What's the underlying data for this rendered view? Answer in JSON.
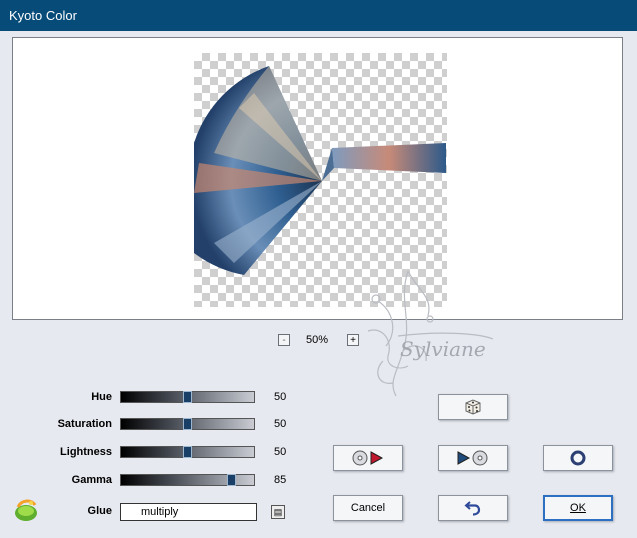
{
  "window": {
    "title": "Kyoto Color"
  },
  "zoom": {
    "minus_label": "-",
    "value": "50%",
    "plus_label": "+"
  },
  "controls": [
    {
      "label": "Hue",
      "value": "50"
    },
    {
      "label": "Saturation",
      "value": "50"
    },
    {
      "label": "Lightness",
      "value": "50"
    },
    {
      "label": "Gamma",
      "value": "85"
    }
  ],
  "glue": {
    "label": "Glue",
    "value": "multiply"
  },
  "buttons": {
    "cancel": "Cancel",
    "ok": "OK"
  },
  "watermark": {
    "text": "Sylviane"
  }
}
